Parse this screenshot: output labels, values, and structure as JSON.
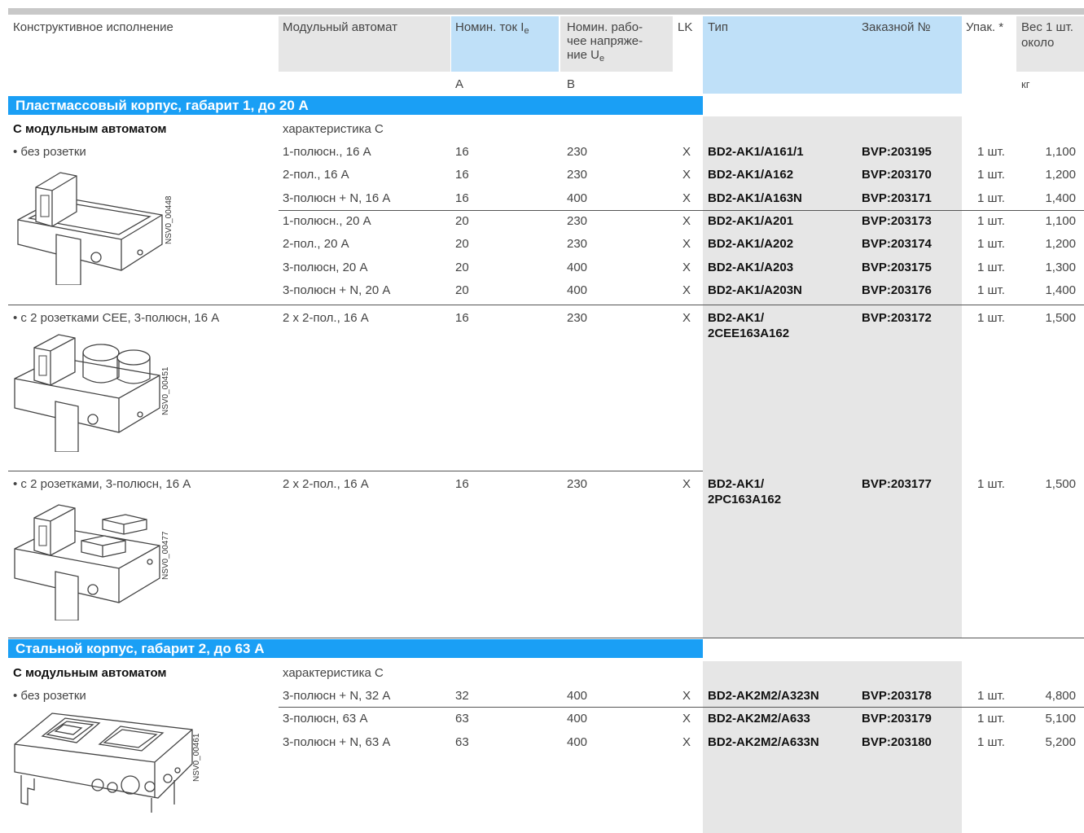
{
  "header": {
    "col1": "Конструктивное исполнение",
    "col2": "Модульный автомат",
    "col3": "Номин. ток I",
    "col3_sub": "e",
    "col4_l1": "Номин. рабо-",
    "col4_l2": "чее напряже-",
    "col4_l3": "ние U",
    "col4_sub": "e",
    "col5": "LK",
    "col6": "Тип",
    "col7": "Заказной №",
    "col8": "Упак. *",
    "col9_l1": "Вес 1 шт.",
    "col9_l2": "около",
    "unit_a": "А",
    "unit_v": "В",
    "unit_kg": "кг"
  },
  "sections": [
    {
      "title": "Пластмассовый корпус, габарит 1, до 20 А"
    },
    {
      "title": "Стальной корпус, габарит 2, до 63 А"
    }
  ],
  "labels": {
    "with_mcb": "С модульным автоматом",
    "char_c": "характеристика C",
    "no_socket": "• без розетки",
    "cee_sockets": "• с 2 розетками CEE, 3-полюсн, 16 А",
    "two_sockets": "• с 2 розетками, 3-полюсн, 16 А",
    "img1": "NSV0_00448",
    "img2": "NSV0_00451",
    "img3": "NSV0_00477",
    "img4": "NSV0_00461"
  },
  "rows": [
    {
      "mcb": "1-полюсн., 16 А",
      "a": "16",
      "v": "230",
      "lk": "X",
      "type": "BD2-AK1/A161/1",
      "order": "BVP:203195",
      "pack": "1 шт.",
      "kg": "1,100"
    },
    {
      "mcb": "2-пол., 16 А",
      "a": "16",
      "v": "230",
      "lk": "X",
      "type": "BD2-AK1/A162",
      "order": "BVP:203170",
      "pack": "1 шт.",
      "kg": "1,200"
    },
    {
      "mcb": "3-полюсн + N, 16 А",
      "a": "16",
      "v": "400",
      "lk": "X",
      "type": "BD2-AK1/A163N",
      "order": "BVP:203171",
      "pack": "1 шт.",
      "kg": "1,400"
    },
    {
      "mcb": "1-полюсн., 20 А",
      "a": "20",
      "v": "230",
      "lk": "X",
      "type": "BD2-AK1/A201",
      "order": "BVP:203173",
      "pack": "1 шт.",
      "kg": "1,100"
    },
    {
      "mcb": "2-пол., 20 А",
      "a": "20",
      "v": "230",
      "lk": "X",
      "type": "BD2-AK1/A202",
      "order": "BVP:203174",
      "pack": "1 шт.",
      "kg": "1,200"
    },
    {
      "mcb": "3-полюсн, 20 А",
      "a": "20",
      "v": "400",
      "lk": "X",
      "type": "BD2-AK1/A203",
      "order": "BVP:203175",
      "pack": "1 шт.",
      "kg": "1,300"
    },
    {
      "mcb": "3-полюсн + N, 20 А",
      "a": "20",
      "v": "400",
      "lk": "X",
      "type": "BD2-AK1/A203N",
      "order": "BVP:203176",
      "pack": "1 шт.",
      "kg": "1,400"
    },
    {
      "mcb": "2 x 2-пол., 16 А",
      "a": "16",
      "v": "230",
      "lk": "X",
      "type1": "BD2-AK1/",
      "type2": "2CEE163A162",
      "order": "BVP:203172",
      "pack": "1 шт.",
      "kg": "1,500"
    },
    {
      "mcb": "2 x 2-пол., 16 А",
      "a": "16",
      "v": "230",
      "lk": "X",
      "type1": "BD2-AK1/",
      "type2": "2PC163A162",
      "order": "BVP:203177",
      "pack": "1 шт.",
      "kg": "1,500"
    },
    {
      "mcb": "3-полюсн + N, 32 А",
      "a": "32",
      "v": "400",
      "lk": "X",
      "type": "BD2-AK2M2/A323N",
      "order": "BVP:203178",
      "pack": "1 шт.",
      "kg": "4,800"
    },
    {
      "mcb": "3-полюсн, 63 А",
      "a": "63",
      "v": "400",
      "lk": "X",
      "type": "BD2-AK2M2/A633",
      "order": "BVP:203179",
      "pack": "1 шт.",
      "kg": "5,100"
    },
    {
      "mcb": "3-полюсн + N, 63 А",
      "a": "63",
      "v": "400",
      "lk": "X",
      "type": "BD2-AK2M2/A633N",
      "order": "BVP:203180",
      "pack": "1 шт.",
      "kg": "5,200"
    }
  ]
}
